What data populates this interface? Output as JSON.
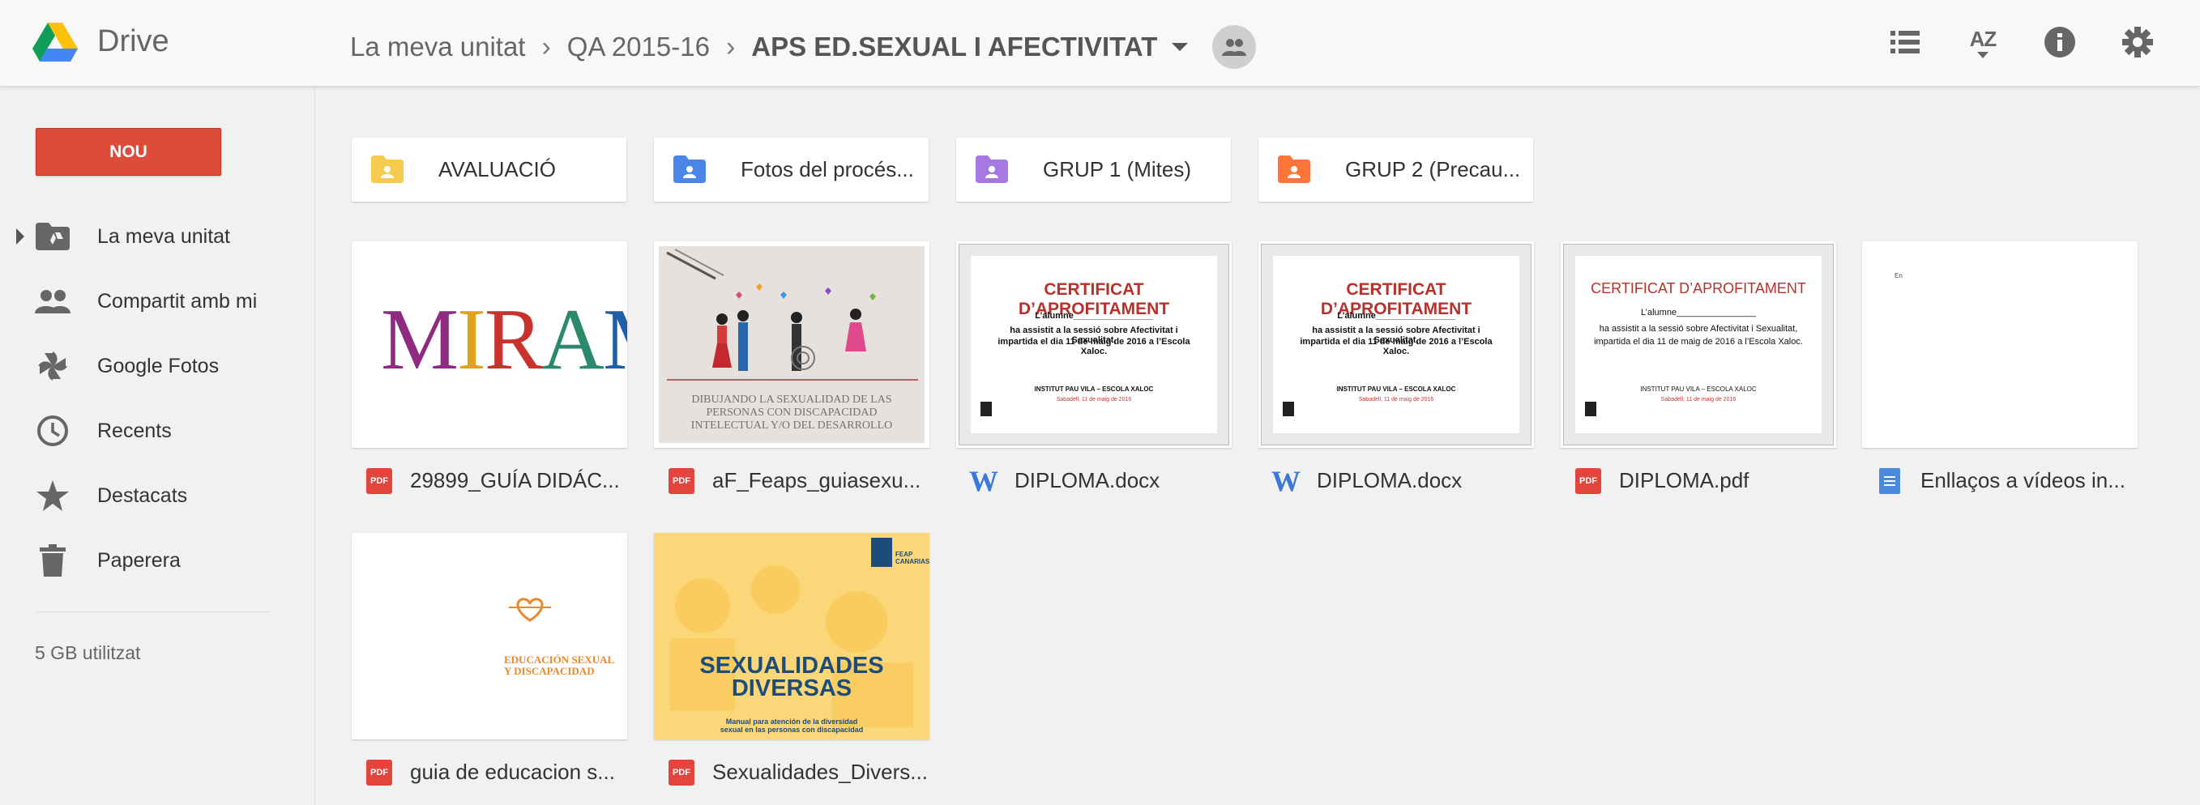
{
  "header": {
    "app_name": "Drive",
    "breadcrumb": [
      "La meva unitat",
      "QA 2015-16",
      "APS ED.SEXUAL I AFECTIVITAT"
    ],
    "icons": [
      "list-view-icon",
      "sort-az-icon",
      "info-icon",
      "settings-icon"
    ],
    "sort_label": "AZ"
  },
  "sidebar": {
    "new_button": "NOU",
    "items": [
      {
        "label": "La meva unitat",
        "icon": "drive-folder-icon"
      },
      {
        "label": "Compartit amb mi",
        "icon": "people-icon"
      },
      {
        "label": "Google Fotos",
        "icon": "pinwheel-icon"
      },
      {
        "label": "Recents",
        "icon": "clock-icon"
      },
      {
        "label": "Destacats",
        "icon": "star-icon"
      },
      {
        "label": "Paperera",
        "icon": "trash-icon"
      }
    ],
    "storage": "5 GB utilitzat"
  },
  "folders": [
    {
      "name": "AVALUACIÓ",
      "color": "#f7cb4d"
    },
    {
      "name": "Fotos del procés...",
      "color": "#4a86e8"
    },
    {
      "name": "GRUP 1 (Mites)",
      "color": "#a47ae2"
    },
    {
      "name": "GRUP 2 (Precau...",
      "color": "#ff7537"
    }
  ],
  "files": [
    {
      "name": "29899_GUÍA DIDÁC...",
      "type": "pdf"
    },
    {
      "name": "aF_Feaps_guiasexu...",
      "type": "pdf"
    },
    {
      "name": "DIPLOMA.docx",
      "type": "word"
    },
    {
      "name": "DIPLOMA.docx",
      "type": "word"
    },
    {
      "name": "DIPLOMA.pdf",
      "type": "pdf"
    },
    {
      "name": "Enllaços a vídeos in...",
      "type": "doc"
    },
    {
      "name": "guia de educacion s...",
      "type": "pdf"
    },
    {
      "name": "Sexualidades_Divers...",
      "type": "pdf"
    }
  ],
  "file_type_badge": "PDF",
  "thumbnails": {
    "mirame": "MIRAME",
    "feaps_lines": [
      "DIBUJANDO LA SEXUALIDAD DE LAS",
      "PERSONAS CON DISCAPACIDAD",
      "INTELECTUAL Y/O DEL DESARROLLO"
    ],
    "cert_title": "CERTIFICAT D’APROFITAMENT",
    "cert_student": "L’alumne________________",
    "cert_body_1": "ha assistit a la sessió sobre Afectivitat i Sexualitat,",
    "cert_body_2": "impartida el dia 11 de maig de 2016 a l’Escola Xaloc.",
    "cert_school": "INSTITUT PAU VILA – ESCOLA XALOC",
    "cert_date": "Sabadell, 11 de maig de 2016",
    "enllacos_text": "En",
    "guia_title_1": "EDUCACIÓN SEXUAL",
    "guia_title_2": "Y DISCAPACIDAD",
    "sexu_logo": "FEAP CANARIAS",
    "sexu_title_1": "SEXUALIDADES",
    "sexu_title_2": "DIVERSAS",
    "sexu_sub": "Manual para atención de la diversidad sexual en las personas con discapacidad"
  }
}
